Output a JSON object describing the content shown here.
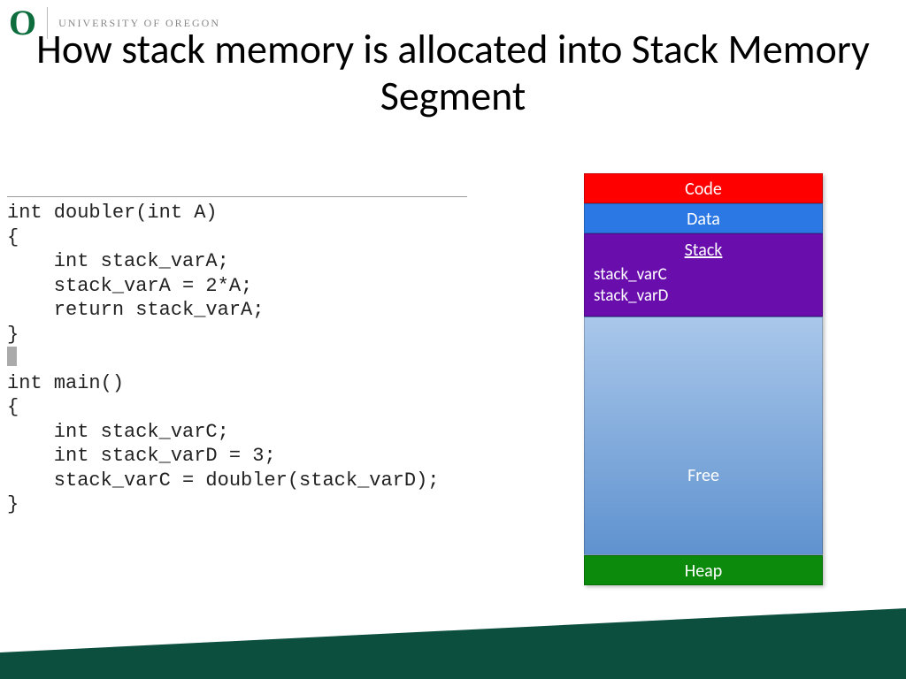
{
  "logo": {
    "letter": "O",
    "text": "UNIVERSITY OF OREGON"
  },
  "title": "How stack memory is allocated into Stack Memory Segment",
  "code": {
    "line1": "int doubler(int A)",
    "line2": "{",
    "line3": "    int stack_varA;",
    "line4": "    stack_varA = 2*A;",
    "line5": "    return stack_varA;",
    "line6": "}",
    "line7": "int main()",
    "line8": "{",
    "line9": "    int stack_varC;",
    "line10": "    int stack_varD = 3;",
    "line11": "    stack_varC = doubler(stack_varD);",
    "line12": "}"
  },
  "memory": {
    "code": "Code",
    "data": "Data",
    "stack_title": "Stack",
    "stack_vars": [
      "stack_varC",
      "stack_varD"
    ],
    "free": "Free",
    "heap": "Heap"
  },
  "colors": {
    "code": "#ff0000",
    "data": "#2b78e4",
    "stack": "#6a0dad",
    "heap": "#0b8a0b",
    "footer": "#0c4f3e"
  }
}
